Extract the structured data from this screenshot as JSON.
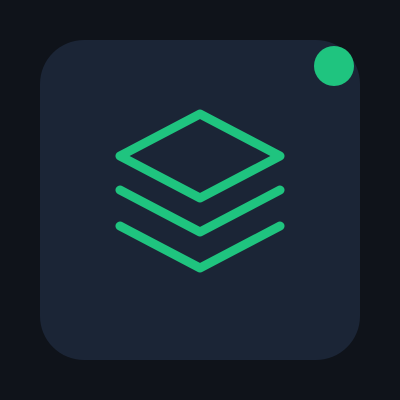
{
  "app_tile": {
    "icon": "layers-icon",
    "background_color": "#1b2536"
  },
  "badge": {
    "icon": "status-dot",
    "color": "#1fc47f"
  },
  "colors": {
    "page_background": "#0f131a",
    "accent": "#1fc47f"
  }
}
